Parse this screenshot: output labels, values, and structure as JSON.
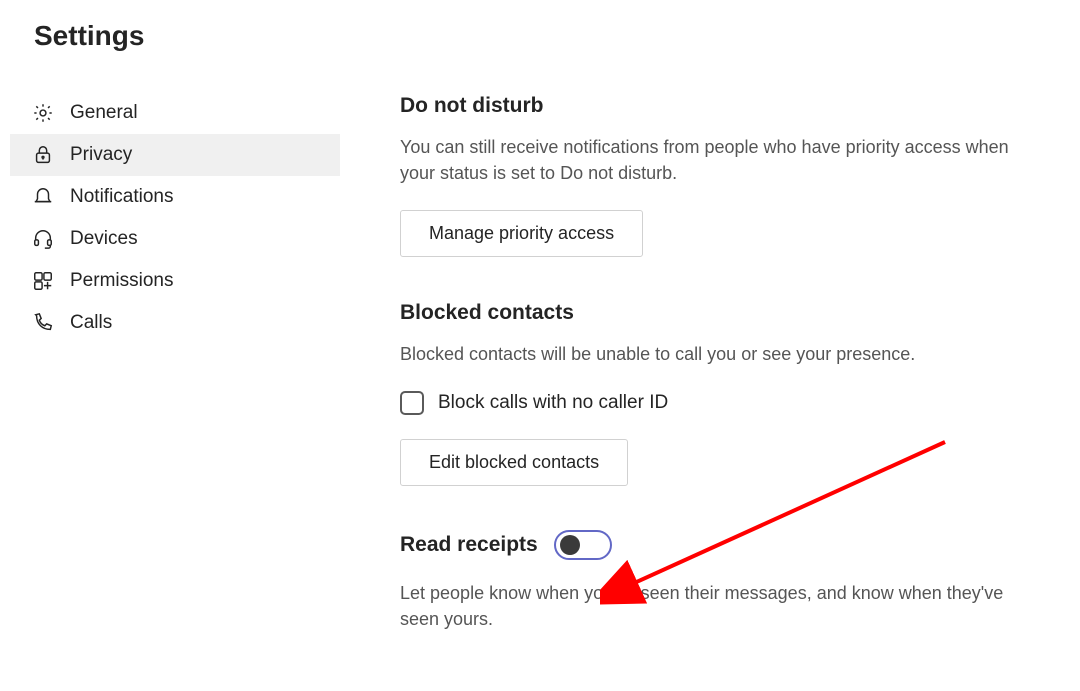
{
  "page": {
    "title": "Settings"
  },
  "sidebar": {
    "items": [
      {
        "label": "General"
      },
      {
        "label": "Privacy"
      },
      {
        "label": "Notifications"
      },
      {
        "label": "Devices"
      },
      {
        "label": "Permissions"
      },
      {
        "label": "Calls"
      }
    ]
  },
  "dnd": {
    "heading": "Do not disturb",
    "desc": "You can still receive notifications from people who have priority access when your status is set to Do not disturb.",
    "button": "Manage priority access"
  },
  "blocked": {
    "heading": "Blocked contacts",
    "desc": "Blocked contacts will be unable to call you or see your presence.",
    "checkbox_label": "Block calls with no caller ID",
    "button": "Edit blocked contacts"
  },
  "read": {
    "heading": "Read receipts",
    "desc": "Let people know when you've seen their messages, and know when they've seen yours."
  }
}
